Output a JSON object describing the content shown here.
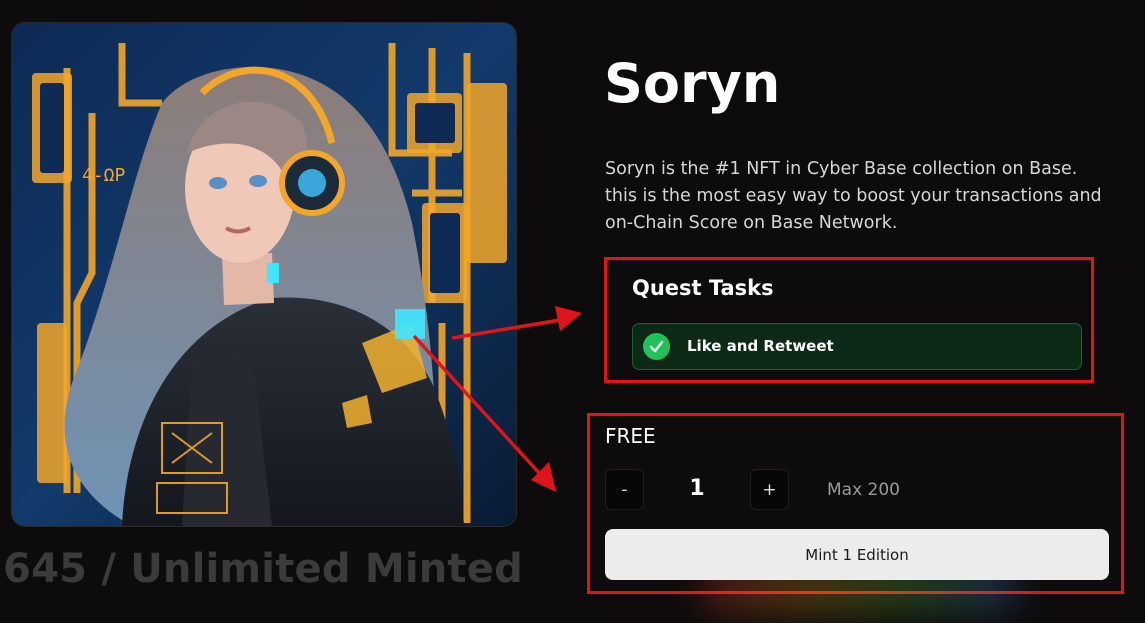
{
  "nft": {
    "name": "Soryn",
    "description": "Soryn is the #1 NFT in Cyber Base collection on Base. this is the most easy way to boost your transactions and on-Chain Score on Base Network.",
    "minted_text": "645 / Unlimited Minted"
  },
  "quest": {
    "title": "Quest Tasks",
    "tasks": [
      {
        "label": "Like and Retweet",
        "completed": true
      }
    ]
  },
  "mint": {
    "price": "FREE",
    "minus": "-",
    "quantity": "1",
    "plus": "+",
    "max": "Max 200",
    "button": "Mint 1 Edition"
  },
  "colors": {
    "background": "#0d0b0b",
    "highlight_border": "#e0141b",
    "task_bg": "#0d2a16",
    "check": "#1fc35a",
    "mint_button": "#ececec"
  },
  "icons": [
    "checkmark-icon",
    "annotation-arrow"
  ]
}
